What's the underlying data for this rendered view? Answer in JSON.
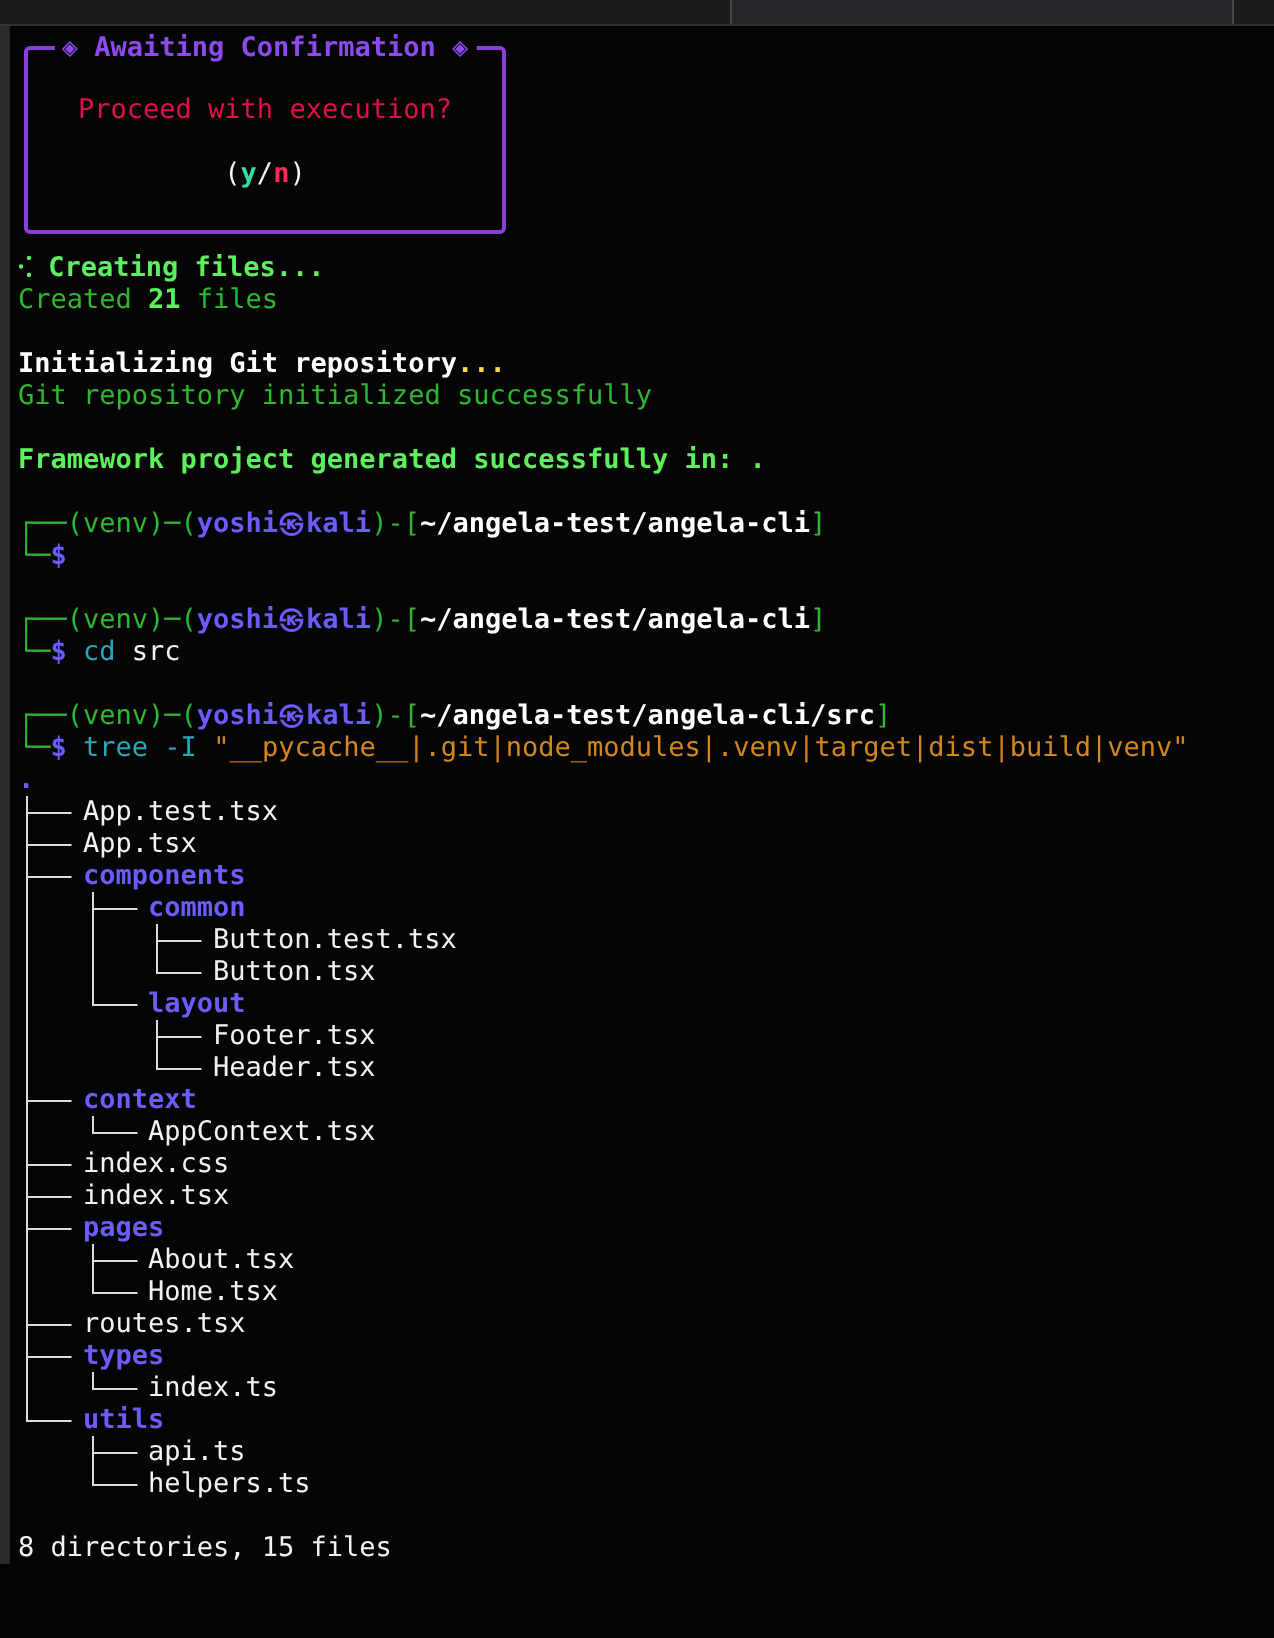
{
  "confirm_box": {
    "title": "◈ Awaiting Confirmation ◈",
    "question": "Proceed with execution?",
    "choice": [
      {
        "text": "(",
        "kind": "bracket"
      },
      {
        "text": "y",
        "kind": "yes"
      },
      {
        "text": "/",
        "kind": "slash"
      },
      {
        "text": "n",
        "kind": "no"
      },
      {
        "text": ")",
        "kind": "bracket"
      }
    ]
  },
  "blocks": [
    {
      "kind": "output",
      "lines": [
        [
          {
            "text": "⁖ Creating files...",
            "kind": "status"
          }
        ],
        [
          {
            "text": "Created ",
            "kind": "message"
          },
          {
            "text": "21",
            "kind": "count"
          },
          {
            "text": " files",
            "kind": "message"
          }
        ]
      ]
    },
    {
      "kind": "output",
      "lines": [
        [
          {
            "text": "Initializing Git repository",
            "kind": "heading"
          },
          {
            "text": "...",
            "kind": "ellipsis"
          }
        ],
        [
          {
            "text": "Git repository initialized successfully",
            "kind": "message"
          }
        ]
      ]
    },
    {
      "kind": "output",
      "lines": [
        [
          {
            "text": "Framework project generated successfully in: .",
            "kind": "status"
          }
        ]
      ]
    },
    {
      "kind": "prompt",
      "lines": [
        [
          {
            "text": "┌──(venv)─(",
            "kind": "frame"
          },
          {
            "text": "yoshi㉿kali",
            "kind": "user"
          },
          {
            "text": ")-[",
            "kind": "frame"
          },
          {
            "text": "~/angela-test/angela-cli",
            "kind": "path"
          },
          {
            "text": "]",
            "kind": "frame"
          }
        ],
        [
          {
            "text": "└─",
            "kind": "frame"
          },
          {
            "text": "$",
            "kind": "user"
          }
        ]
      ]
    },
    {
      "kind": "prompt",
      "lines": [
        [
          {
            "text": "┌──(venv)─(",
            "kind": "frame"
          },
          {
            "text": "yoshi㉿kali",
            "kind": "user"
          },
          {
            "text": ")-[",
            "kind": "frame"
          },
          {
            "text": "~/angela-test/angela-cli",
            "kind": "path"
          },
          {
            "text": "]",
            "kind": "frame"
          }
        ],
        [
          {
            "text": "└─",
            "kind": "frame"
          },
          {
            "text": "$ ",
            "kind": "user"
          },
          {
            "text": "cd ",
            "kind": "command"
          },
          {
            "text": "src",
            "kind": "argument"
          }
        ]
      ]
    },
    {
      "kind": "prompt",
      "lines": [
        [
          {
            "text": "┌──(venv)─(",
            "kind": "frame"
          },
          {
            "text": "yoshi㉿kali",
            "kind": "user"
          },
          {
            "text": ")-[",
            "kind": "frame"
          },
          {
            "text": "~/angela-test/angela-cli/src",
            "kind": "path"
          },
          {
            "text": "]",
            "kind": "frame"
          }
        ],
        [
          {
            "text": "└─",
            "kind": "frame"
          },
          {
            "text": "$ ",
            "kind": "user"
          },
          {
            "text": "tree -I ",
            "kind": "command"
          },
          {
            "text": "\"__pycache__|.git|node_modules|.venv|target|dist|build|venv\"",
            "kind": "pattern"
          }
        ]
      ]
    }
  ],
  "tree": {
    "root": ".",
    "children": [
      {
        "name": "App.test.tsx",
        "kind": "file"
      },
      {
        "name": "App.tsx",
        "kind": "file"
      },
      {
        "name": "components",
        "kind": "dir",
        "children": [
          {
            "name": "common",
            "kind": "dir",
            "children": [
              {
                "name": "Button.test.tsx",
                "kind": "file"
              },
              {
                "name": "Button.tsx",
                "kind": "file"
              }
            ]
          },
          {
            "name": "layout",
            "kind": "dir",
            "children": [
              {
                "name": "Footer.tsx",
                "kind": "file"
              },
              {
                "name": "Header.tsx",
                "kind": "file"
              }
            ]
          }
        ]
      },
      {
        "name": "context",
        "kind": "dir",
        "children": [
          {
            "name": "AppContext.tsx",
            "kind": "file"
          }
        ]
      },
      {
        "name": "index.css",
        "kind": "file"
      },
      {
        "name": "index.tsx",
        "kind": "file"
      },
      {
        "name": "pages",
        "kind": "dir",
        "children": [
          {
            "name": "About.tsx",
            "kind": "file"
          },
          {
            "name": "Home.tsx",
            "kind": "file"
          }
        ]
      },
      {
        "name": "routes.tsx",
        "kind": "file"
      },
      {
        "name": "types",
        "kind": "dir",
        "children": [
          {
            "name": "index.ts",
            "kind": "file"
          }
        ]
      },
      {
        "name": "utils",
        "kind": "dir",
        "children": [
          {
            "name": "api.ts",
            "kind": "file"
          },
          {
            "name": "helpers.ts",
            "kind": "file"
          }
        ]
      }
    ]
  },
  "summary": "8 directories, 15 files"
}
